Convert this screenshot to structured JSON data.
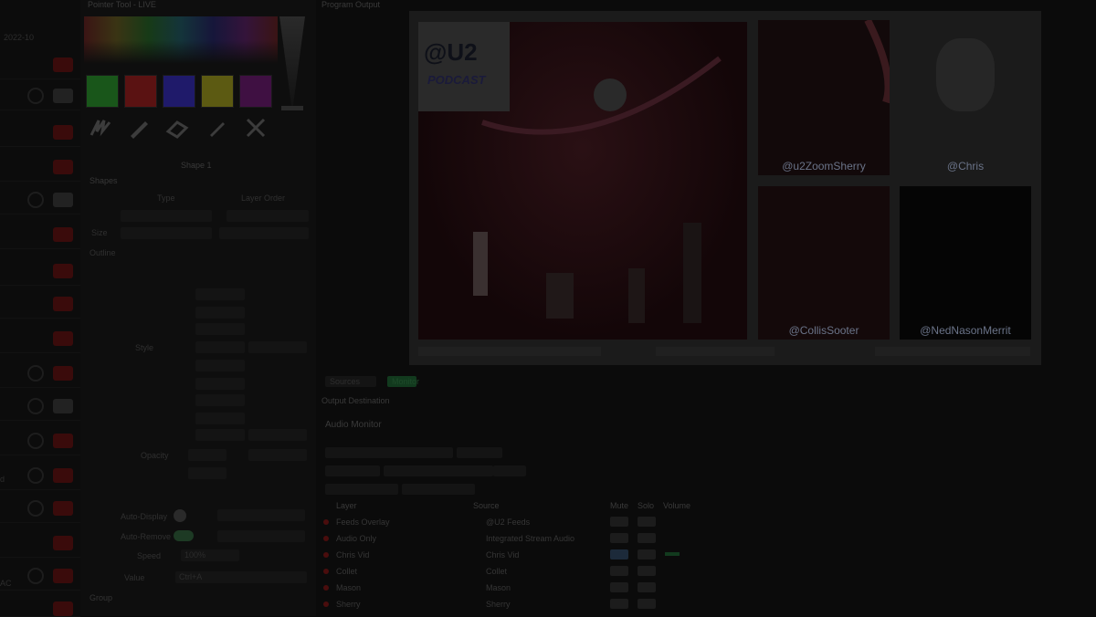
{
  "window": {
    "title": "Pointer Tool - LIVE"
  },
  "program": {
    "title": "Program Output"
  },
  "rail": {
    "top_label": "2022-10",
    "side_label_1": "d",
    "side_label_2": "AC"
  },
  "inspector": {
    "swatches": [
      "#19561a",
      "#5a1212",
      "#1f1a6a",
      "#5c5a12",
      "#3f1042"
    ],
    "tools": [
      {
        "icon": "scribble-icon"
      },
      {
        "icon": "pencil-icon"
      },
      {
        "icon": "eraser-icon"
      },
      {
        "icon": "pen-icon"
      },
      {
        "icon": "close-icon"
      }
    ],
    "layer_name": "Shape 1",
    "shapes_title": "Shapes",
    "col_headers": [
      "Type",
      "Layer Order"
    ],
    "size_label": "Size",
    "outline_label": "Outline",
    "style_label": "Style",
    "opacity_label": "Opacity",
    "auto_display_label": "Auto-Display",
    "auto_remove_label": "Auto-Remove",
    "speed_label": "Speed",
    "speed_value": "100%",
    "label_value": "Value",
    "value_text": "Ctrl+A",
    "group_title": "Group"
  },
  "tiles": [
    {
      "label": "@u2ZoomSherry"
    },
    {
      "label": "@Chris"
    },
    {
      "label": "@CollisSooter"
    },
    {
      "label": "@NedNasonMerrit"
    }
  ],
  "logo": {
    "text": "@U2",
    "sub": "PODCAST"
  },
  "mixer": {
    "tabs": [
      "Sources",
      "Monitor"
    ],
    "output_title": "Output Destination",
    "monitor_title": "Audio Monitor",
    "col_layer": "Layer",
    "col_source": "Source",
    "col_mute": "Mute",
    "col_solo": "Solo",
    "col_volume": "Volume",
    "rows": [
      {
        "layer": "Feeds Overlay",
        "source": "@U2 Feeds"
      },
      {
        "layer": "Audio Only",
        "source": "Integrated Stream Audio"
      },
      {
        "layer": "Chris Vid",
        "source": "Chris Vid"
      },
      {
        "layer": "Collet",
        "source": "Collet"
      },
      {
        "layer": "Mason",
        "source": "Mason"
      },
      {
        "layer": "Sherry",
        "source": "Sherry"
      }
    ]
  }
}
